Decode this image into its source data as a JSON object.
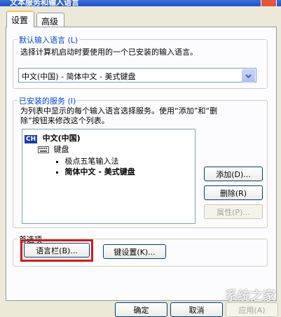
{
  "window": {
    "title": "文本服务和输入语言"
  },
  "tabs": [
    {
      "label": "设置"
    },
    {
      "label": "高级"
    }
  ],
  "default_language": {
    "legend": "默认输入语言 (L)",
    "description": "选择计算机启动时要使用的一个已安装的输入语言。",
    "selected": "中文(中国) - 简体中文 - 美式键盘"
  },
  "installed_services": {
    "legend": "已安装的服务 (I)",
    "description_line1": "为列表中显示的每个输入语言选择服务。使用“添加”和“删",
    "description_line2": "除”按钮来修改这个列表。",
    "tree": {
      "language_badge": "CH",
      "language": "中文(中国)",
      "category": "键盘",
      "items": [
        {
          "label": "极点五笔输入法"
        },
        {
          "label": "简体中文 - 美式键盘"
        }
      ]
    },
    "buttons": {
      "add": "添加(D)...",
      "remove": "删除(R)",
      "properties": "属性(P)..."
    }
  },
  "preferences": {
    "legend": "首选项",
    "language_bar_button": "语言栏(B)...",
    "key_settings_button": "键设置(K)..."
  },
  "footer": {
    "ok": "确定",
    "cancel": "取消",
    "apply": "应用(A)"
  },
  "watermark": "系统之家"
}
